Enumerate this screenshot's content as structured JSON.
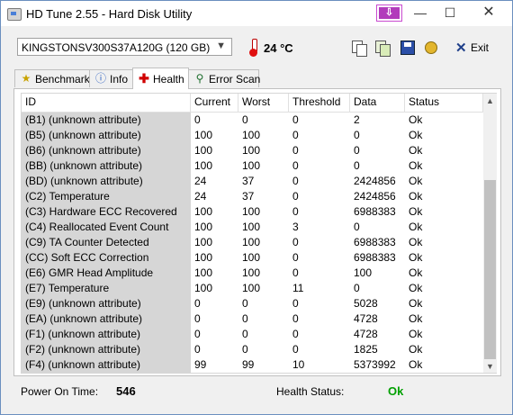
{
  "window": {
    "title": "HD Tune 2.55 - Hard Disk Utility",
    "controls": {
      "minimize": "—",
      "maximize": "☐",
      "close": "✕",
      "extra": "⇩"
    }
  },
  "toolbar": {
    "drive": "KINGSTONSV300S37A120G (120 GB)",
    "temperature": "24 °C",
    "exit_label": "Exit",
    "exit_symbol": "✕"
  },
  "tabs": [
    {
      "label": "Benchmark",
      "icon": "benchmark-icon",
      "active": false
    },
    {
      "label": "Info",
      "icon": "info-icon",
      "active": false
    },
    {
      "label": "Health",
      "icon": "health-cross-icon",
      "active": true
    },
    {
      "label": "Error Scan",
      "icon": "magnifier-icon",
      "active": false
    }
  ],
  "table": {
    "headers": {
      "id": "ID",
      "current": "Current",
      "worst": "Worst",
      "threshold": "Threshold",
      "data": "Data",
      "status": "Status"
    },
    "rows": [
      {
        "id": "(B1) (unknown attribute)",
        "current": "0",
        "worst": "0",
        "threshold": "0",
        "data": "2",
        "status": "Ok"
      },
      {
        "id": "(B5) (unknown attribute)",
        "current": "100",
        "worst": "100",
        "threshold": "0",
        "data": "0",
        "status": "Ok"
      },
      {
        "id": "(B6) (unknown attribute)",
        "current": "100",
        "worst": "100",
        "threshold": "0",
        "data": "0",
        "status": "Ok"
      },
      {
        "id": "(BB) (unknown attribute)",
        "current": "100",
        "worst": "100",
        "threshold": "0",
        "data": "0",
        "status": "Ok"
      },
      {
        "id": "(BD) (unknown attribute)",
        "current": "24",
        "worst": "37",
        "threshold": "0",
        "data": "2424856",
        "status": "Ok"
      },
      {
        "id": "(C2) Temperature",
        "current": "24",
        "worst": "37",
        "threshold": "0",
        "data": "2424856",
        "status": "Ok"
      },
      {
        "id": "(C3) Hardware ECC Recovered",
        "current": "100",
        "worst": "100",
        "threshold": "0",
        "data": "6988383",
        "status": "Ok"
      },
      {
        "id": "(C4) Reallocated Event Count",
        "current": "100",
        "worst": "100",
        "threshold": "3",
        "data": "0",
        "status": "Ok"
      },
      {
        "id": "(C9) TA Counter Detected",
        "current": "100",
        "worst": "100",
        "threshold": "0",
        "data": "6988383",
        "status": "Ok"
      },
      {
        "id": "(CC) Soft ECC Correction",
        "current": "100",
        "worst": "100",
        "threshold": "0",
        "data": "6988383",
        "status": "Ok"
      },
      {
        "id": "(E6) GMR Head Amplitude",
        "current": "100",
        "worst": "100",
        "threshold": "0",
        "data": "100",
        "status": "Ok"
      },
      {
        "id": "(E7) Temperature",
        "current": "100",
        "worst": "100",
        "threshold": "11",
        "data": "0",
        "status": "Ok"
      },
      {
        "id": "(E9) (unknown attribute)",
        "current": "0",
        "worst": "0",
        "threshold": "0",
        "data": "5028",
        "status": "Ok"
      },
      {
        "id": "(EA) (unknown attribute)",
        "current": "0",
        "worst": "0",
        "threshold": "0",
        "data": "4728",
        "status": "Ok"
      },
      {
        "id": "(F1) (unknown attribute)",
        "current": "0",
        "worst": "0",
        "threshold": "0",
        "data": "4728",
        "status": "Ok"
      },
      {
        "id": "(F2) (unknown attribute)",
        "current": "0",
        "worst": "0",
        "threshold": "0",
        "data": "1825",
        "status": "Ok"
      },
      {
        "id": "(F4) (unknown attribute)",
        "current": "99",
        "worst": "99",
        "threshold": "10",
        "data": "5373992",
        "status": "Ok"
      }
    ]
  },
  "status_bar": {
    "power_on_label": "Power On Time:",
    "power_on_value": "546",
    "health_label": "Health Status:",
    "health_value": "Ok",
    "health_color": "#00a000"
  }
}
